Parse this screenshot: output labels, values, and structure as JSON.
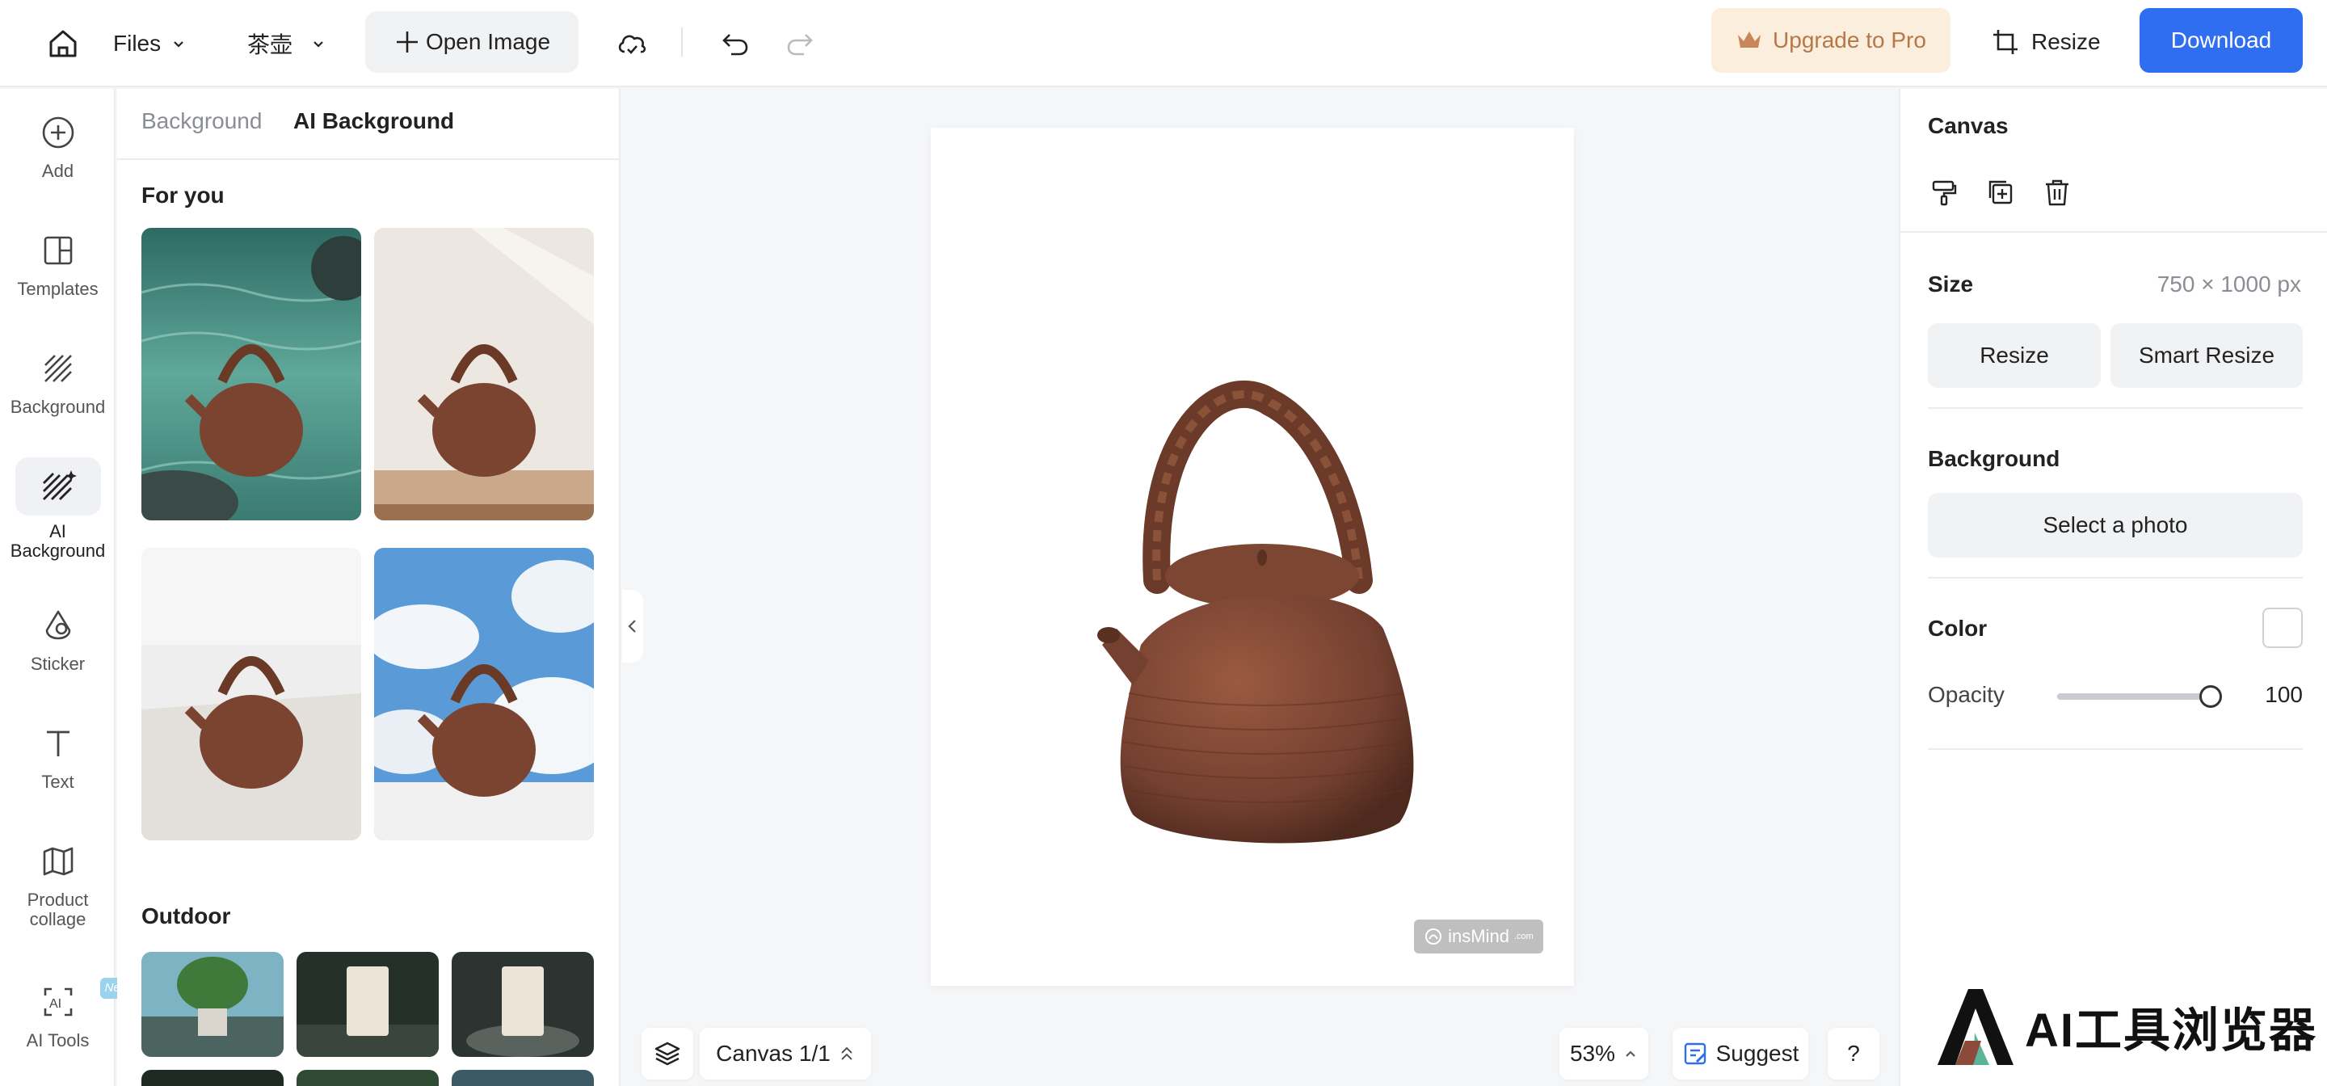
{
  "topbar": {
    "files_label": "Files",
    "project_name": "茶壶",
    "open_image_label": "Open Image",
    "upgrade_label": "Upgrade to Pro",
    "resize_label": "Resize",
    "download_label": "Download"
  },
  "rail": {
    "items": [
      {
        "label": "Add",
        "icon": "plus-circle-icon"
      },
      {
        "label": "Templates",
        "icon": "templates-icon"
      },
      {
        "label": "Background",
        "icon": "hatch-icon"
      },
      {
        "label": "AI Background",
        "icon": "ai-hatch-icon"
      },
      {
        "label": "Sticker",
        "icon": "sticker-icon"
      },
      {
        "label": "Text",
        "icon": "text-icon"
      },
      {
        "label": "Product collage",
        "icon": "collage-icon"
      },
      {
        "label": "AI Tools",
        "icon": "ai-tools-icon",
        "badge": "New"
      }
    ],
    "active": "AI Background"
  },
  "panel": {
    "tabs": [
      {
        "label": "Background"
      },
      {
        "label": "AI Background"
      }
    ],
    "sections": [
      {
        "title": "For you"
      },
      {
        "title": "Outdoor"
      }
    ]
  },
  "stage": {
    "watermark": "insMind",
    "watermark_suffix": ".com",
    "canvas_label": "Canvas 1/1",
    "zoom": "53%",
    "suggest_label": "Suggest",
    "help_label": "?"
  },
  "right_panel": {
    "title": "Canvas",
    "size_label": "Size",
    "size_value": "750 × 1000 px",
    "resize_button": "Resize",
    "smart_resize_button": "Smart Resize",
    "background_label": "Background",
    "select_photo_button": "Select a photo",
    "color_label": "Color",
    "opacity_label": "Opacity",
    "opacity_value": "100"
  },
  "brand": {
    "text": "AI工具浏览器"
  },
  "colors": {
    "accent": "#2f6ef0",
    "upgrade_bg": "#fbeedc",
    "upgrade_text": "#b4784a"
  }
}
